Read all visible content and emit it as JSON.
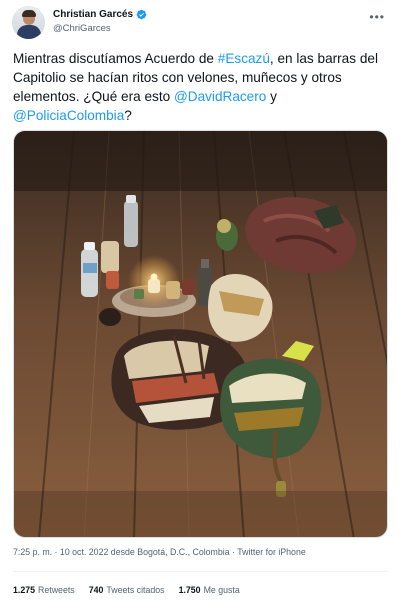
{
  "tweet": {
    "author_name": "Christian Garcés",
    "author_handle": "@ChriGarces",
    "text_before": "Mientras discutíamos Acuerdo de ",
    "hashtag": "#Escazú",
    "text_middle": ", en las barras del Capitolio se hacían ritos con velones, muñecos y otros elementos. ¿Qué era esto ",
    "mention1": "@DavidRacero",
    "text_y": " y ",
    "mention2": "@PoliciaColombia",
    "text_end": "?",
    "meta": "7:25 p. m. · 10 oct. 2022 desde Bogotá, D.C., Colombia · Twitter for iPhone",
    "stats": {
      "retweets_count": "1.275",
      "retweets_label": "Retweets",
      "quotes_count": "740",
      "quotes_label": "Tweets citados",
      "likes_count": "1.750",
      "likes_label": "Me gusta"
    }
  },
  "icons": {
    "verified": "verified-badge-icon",
    "more": "more-options-icon"
  },
  "colors": {
    "link": "#1d9bf0",
    "secondary_text": "#536471",
    "primary_text": "#0f1419"
  }
}
